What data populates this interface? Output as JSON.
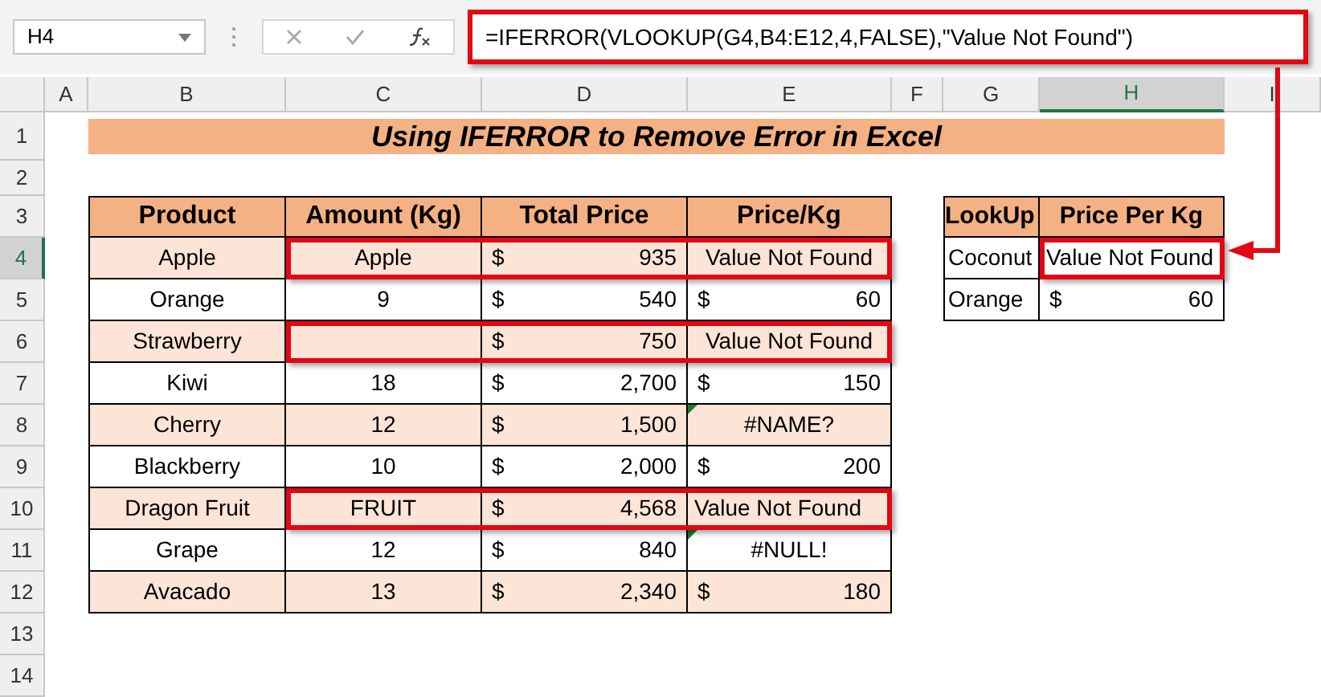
{
  "formula_bar": {
    "name_box": "H4",
    "formula": "=IFERROR(VLOOKUP(G4,B4:E12,4,FALSE),\"Value Not Found\")",
    "highlighted": true
  },
  "columns": [
    {
      "label": "A",
      "selected": false
    },
    {
      "label": "B",
      "selected": false
    },
    {
      "label": "C",
      "selected": false
    },
    {
      "label": "D",
      "selected": false
    },
    {
      "label": "E",
      "selected": false
    },
    {
      "label": "F",
      "selected": false
    },
    {
      "label": "G",
      "selected": false
    },
    {
      "label": "H",
      "selected": true
    },
    {
      "label": "I",
      "selected": false
    }
  ],
  "rows": [
    {
      "label": "1",
      "selected": false
    },
    {
      "label": "2",
      "selected": false
    },
    {
      "label": "3",
      "selected": false
    },
    {
      "label": "4",
      "selected": true
    },
    {
      "label": "5",
      "selected": false
    },
    {
      "label": "6",
      "selected": false
    },
    {
      "label": "7",
      "selected": false
    },
    {
      "label": "8",
      "selected": false
    },
    {
      "label": "9",
      "selected": false
    },
    {
      "label": "10",
      "selected": false
    },
    {
      "label": "11",
      "selected": false
    },
    {
      "label": "12",
      "selected": false
    },
    {
      "label": "13",
      "selected": false
    },
    {
      "label": "14",
      "selected": false
    }
  ],
  "title": "Using IFERROR to Remove Error in Excel",
  "table": {
    "columns": [
      "Product",
      "Amount (Kg)",
      "Total Price",
      "Price/Kg"
    ],
    "rows": [
      {
        "product": "Apple",
        "amount": "Apple",
        "total": {
          "symbol": "$",
          "value": "935"
        },
        "price_per_kg": {
          "kind": "text",
          "value": "Value Not Found",
          "flagged": false
        },
        "highlighted": true
      },
      {
        "product": "Orange",
        "amount": "9",
        "total": {
          "symbol": "$",
          "value": "540"
        },
        "price_per_kg": {
          "kind": "currency",
          "symbol": "$",
          "value": "60",
          "flagged": false
        },
        "highlighted": false
      },
      {
        "product": "Strawberry",
        "total": {
          "symbol": "$",
          "value": "750"
        },
        "price_per_kg": {
          "kind": "text",
          "value": "Value Not Found",
          "flagged": false
        },
        "highlighted": true
      },
      {
        "product": "Kiwi",
        "amount": "18",
        "total": {
          "symbol": "$",
          "value": "2,700"
        },
        "price_per_kg": {
          "kind": "currency",
          "symbol": "$",
          "value": "150",
          "flagged": false
        },
        "highlighted": false
      },
      {
        "product": "Cherry",
        "amount": "12",
        "total": {
          "symbol": "$",
          "value": "1,500"
        },
        "price_per_kg": {
          "kind": "text",
          "value": "#NAME?",
          "flagged": true
        },
        "highlighted": false
      },
      {
        "product": "Blackberry",
        "amount": "10",
        "total": {
          "symbol": "$",
          "value": "2,000"
        },
        "price_per_kg": {
          "kind": "currency",
          "symbol": "$",
          "value": "200",
          "flagged": false
        },
        "highlighted": false
      },
      {
        "product": "Dragon Fruit",
        "amount": "FRUIT",
        "total": {
          "symbol": "$",
          "value": "4,568"
        },
        "price_per_kg": {
          "kind": "text",
          "value": "Value Not Found",
          "flagged": false
        },
        "highlighted": true
      },
      {
        "product": "Grape",
        "amount": "12",
        "total": {
          "symbol": "$",
          "value": "840"
        },
        "price_per_kg": {
          "kind": "text",
          "value": "#NULL!",
          "flagged": true
        },
        "highlighted": false
      },
      {
        "product": "Avacado",
        "amount": "13",
        "total": {
          "symbol": "$",
          "value": "2,340"
        },
        "price_per_kg": {
          "kind": "currency",
          "symbol": "$",
          "value": "180",
          "flagged": false
        },
        "highlighted": false
      }
    ]
  },
  "lookup": {
    "columns": [
      "LookUp",
      "Price Per Kg"
    ],
    "rows": [
      {
        "fruit": "Coconut",
        "price": {
          "kind": "text",
          "value": "Value Not Found"
        },
        "selected": true,
        "highlighted": true
      },
      {
        "fruit": "Orange",
        "price": {
          "kind": "currency",
          "symbol": "$",
          "value": "60"
        },
        "selected": false,
        "highlighted": false
      }
    ]
  }
}
